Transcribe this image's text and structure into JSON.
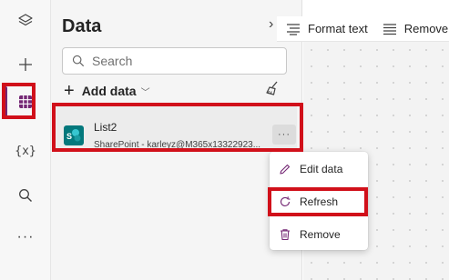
{
  "rail": {
    "items": [
      {
        "icon": "layers-icon"
      },
      {
        "icon": "plus-icon"
      },
      {
        "icon": "data-grid-icon",
        "active": true
      },
      {
        "icon": "variables-icon",
        "label": "{x}"
      },
      {
        "icon": "search-icon"
      },
      {
        "icon": "more-icon",
        "label": "···"
      }
    ]
  },
  "pane": {
    "title": "Data",
    "collapse_glyph": "›",
    "search": {
      "placeholder": "Search"
    },
    "add_data_label": "Add data",
    "list": {
      "name": "List2",
      "subtitle": "SharePoint - karleyz@M365x13322923..."
    }
  },
  "toolbar": {
    "format_text": "Format text",
    "remove": "Remove"
  },
  "context_menu": {
    "items": [
      {
        "label": "Edit data",
        "icon": "pencil-icon"
      },
      {
        "label": "Refresh",
        "icon": "refresh-icon"
      },
      {
        "label": "Remove",
        "icon": "trash-icon"
      }
    ]
  },
  "colors": {
    "accent": "#742774",
    "highlight_box": "#d1101a",
    "sharepoint": "#03787c"
  }
}
